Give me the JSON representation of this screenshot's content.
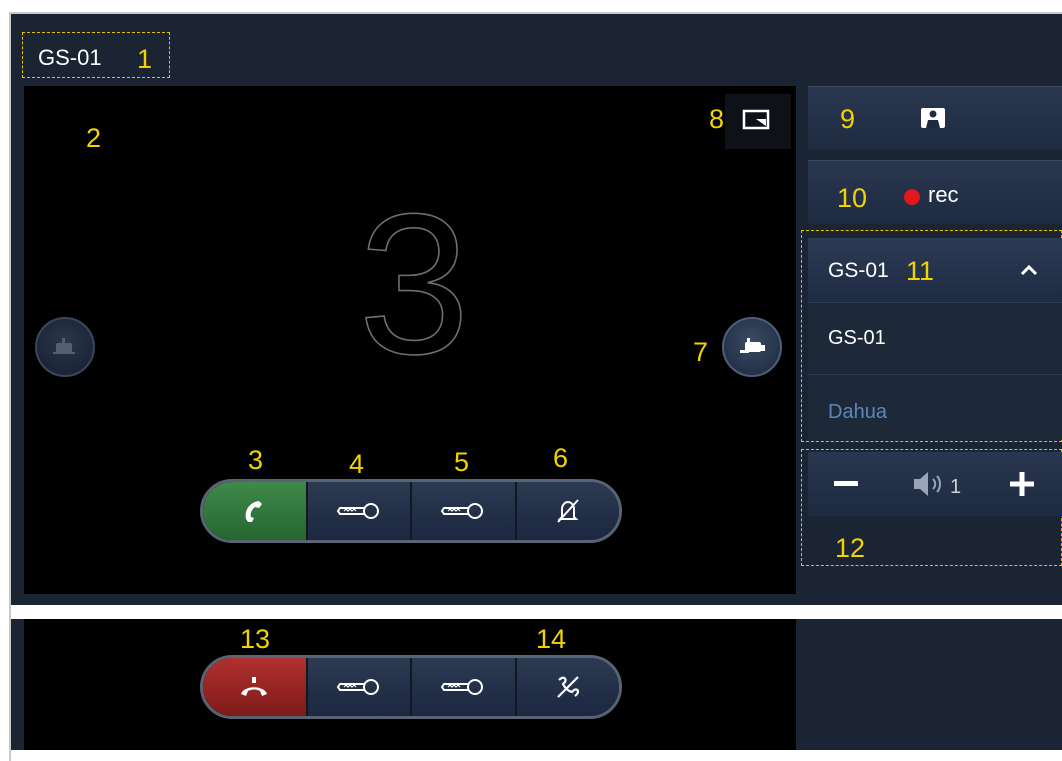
{
  "header": {
    "title": "GS-01"
  },
  "video": {
    "big_number": "3"
  },
  "callouts": {
    "c1": "1",
    "c2": "2",
    "c3": "3",
    "c4": "4",
    "c5": "5",
    "c6": "6",
    "c7": "7",
    "c8": "8",
    "c9": "9",
    "c10": "10",
    "c11": "11",
    "c12": "12",
    "c13": "13",
    "c14": "14"
  },
  "top_controls": [
    "answer-icon",
    "unlock-key-icon",
    "unlock-key-icon",
    "mute-ring-icon"
  ],
  "bottom_controls": [
    "hangup-icon",
    "unlock-key-icon",
    "unlock-key-icon",
    "mute-mic-icon"
  ],
  "sidebar": {
    "snapshot_icon": "snapshot-icon",
    "record_label": "rec",
    "camera_select": {
      "selected": "GS-01",
      "options": [
        "GS-01",
        "Dahua"
      ]
    },
    "volume": {
      "level": "1"
    }
  },
  "colors": {
    "accent_callout": "#f2d300",
    "answer_green": "#3f8a4a",
    "hangup_red": "#b0312f",
    "record_red": "#e3161b",
    "option_blue": "#5d87b8"
  }
}
